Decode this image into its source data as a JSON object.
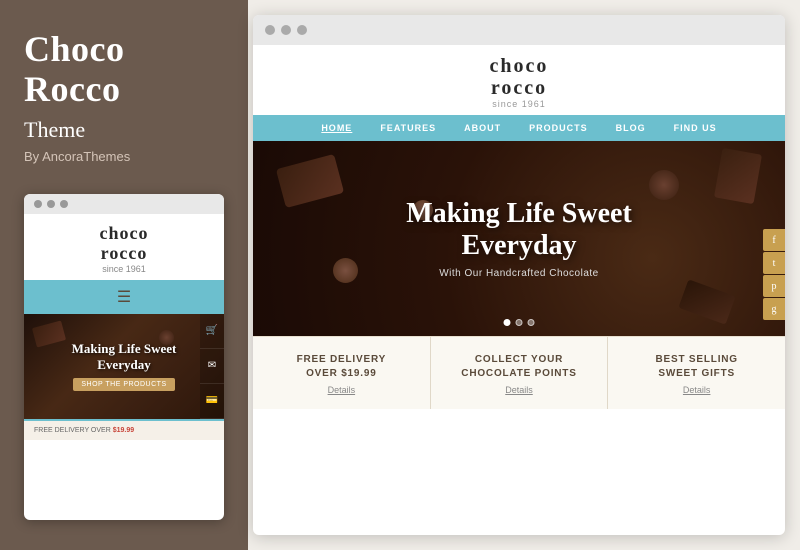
{
  "sidebar": {
    "title_line1": "Choco",
    "title_line2": "Rocco",
    "subtitle": "Theme",
    "by": "By AncoraThemes"
  },
  "mobile_preview": {
    "logo_line1": "choco",
    "logo_line2": "rocco",
    "logo_since": "since 1961",
    "hero_title_line1": "Making Life Sweet",
    "hero_title_line2": "Everyday",
    "hero_button": "SHOP THE PRODUCTS",
    "bottom_text": "FREE DELIVERY OVER",
    "bottom_price": "$19.99"
  },
  "desktop_preview": {
    "logo_line1": "choco",
    "logo_line2": "rocco",
    "logo_since": "since 1961",
    "nav_items": [
      {
        "label": "HOME",
        "active": true
      },
      {
        "label": "FEATURES",
        "active": false
      },
      {
        "label": "ABOUT",
        "active": false
      },
      {
        "label": "PRODUCTS",
        "active": false
      },
      {
        "label": "BLOG",
        "active": false
      },
      {
        "label": "FIND US",
        "active": false
      }
    ],
    "hero_title_line1": "Making Life Sweet",
    "hero_title_line2": "Everyday",
    "hero_subtitle": "With Our Handcrafted Chocolate",
    "features": [
      {
        "title": "FREE DELIVERY\nOVER $19.99",
        "link": "Details"
      },
      {
        "title": "COLLECT YOUR\nCHOCOLATE POINTS",
        "link": "Details"
      },
      {
        "title": "BEST SELLING\nSWEET GIFTS",
        "link": "Details"
      }
    ],
    "social_icons": [
      "f",
      "t",
      "p",
      "g"
    ]
  }
}
